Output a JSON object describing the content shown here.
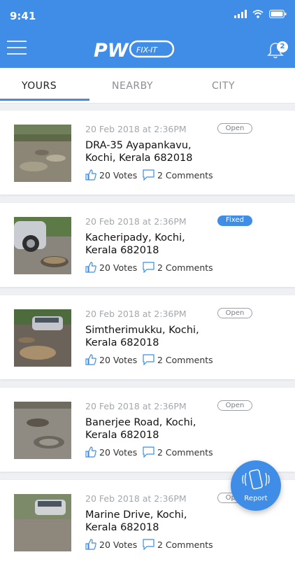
{
  "status_bar": {
    "time": "9:41"
  },
  "header": {
    "logo_text": "PW",
    "logo_sub": "FIX-IT",
    "notification_count": "2"
  },
  "tabs": [
    {
      "label": "YOURS",
      "active": true
    },
    {
      "label": "NEARBY",
      "active": false
    },
    {
      "label": "CITY",
      "active": false
    }
  ],
  "reports": [
    {
      "date": "20 Feb 2018 at 2:36PM",
      "address": "DRA-35 Ayapankavu, Kochi, Kerala 682018",
      "votes": "20 Votes",
      "comments": "2 Comments",
      "status": "Open"
    },
    {
      "date": "20 Feb 2018 at 2:36PM",
      "address": "Kacheripady, Kochi, Kerala 682018",
      "votes": "20 Votes",
      "comments": "2 Comments",
      "status": "Fixed"
    },
    {
      "date": "20 Feb 2018 at 2:36PM",
      "address": "Simtherimukku, Kochi, Kerala 682018",
      "votes": "20 Votes",
      "comments": "2 Comments",
      "status": "Open"
    },
    {
      "date": "20 Feb 2018 at 2:36PM",
      "address": "Banerjee Road, Kochi, Kerala 682018",
      "votes": "20 Votes",
      "comments": "2 Comments",
      "status": "Open"
    },
    {
      "date": "20 Feb 2018 at 2:36PM",
      "address": "Marine Drive, Kochi, Kerala 682018",
      "votes": "20 Votes",
      "comments": "2 Comments",
      "status": "Open"
    }
  ],
  "fab": {
    "label": "Report"
  },
  "colors": {
    "primary": "#3f8de6",
    "background": "#eef0f3",
    "card": "#ffffff"
  },
  "icons": [
    "menu-icon",
    "bell-icon",
    "thumbs-up-icon",
    "comment-icon",
    "phone-vibrate-icon",
    "signal-icon",
    "wifi-icon",
    "battery-icon"
  ]
}
